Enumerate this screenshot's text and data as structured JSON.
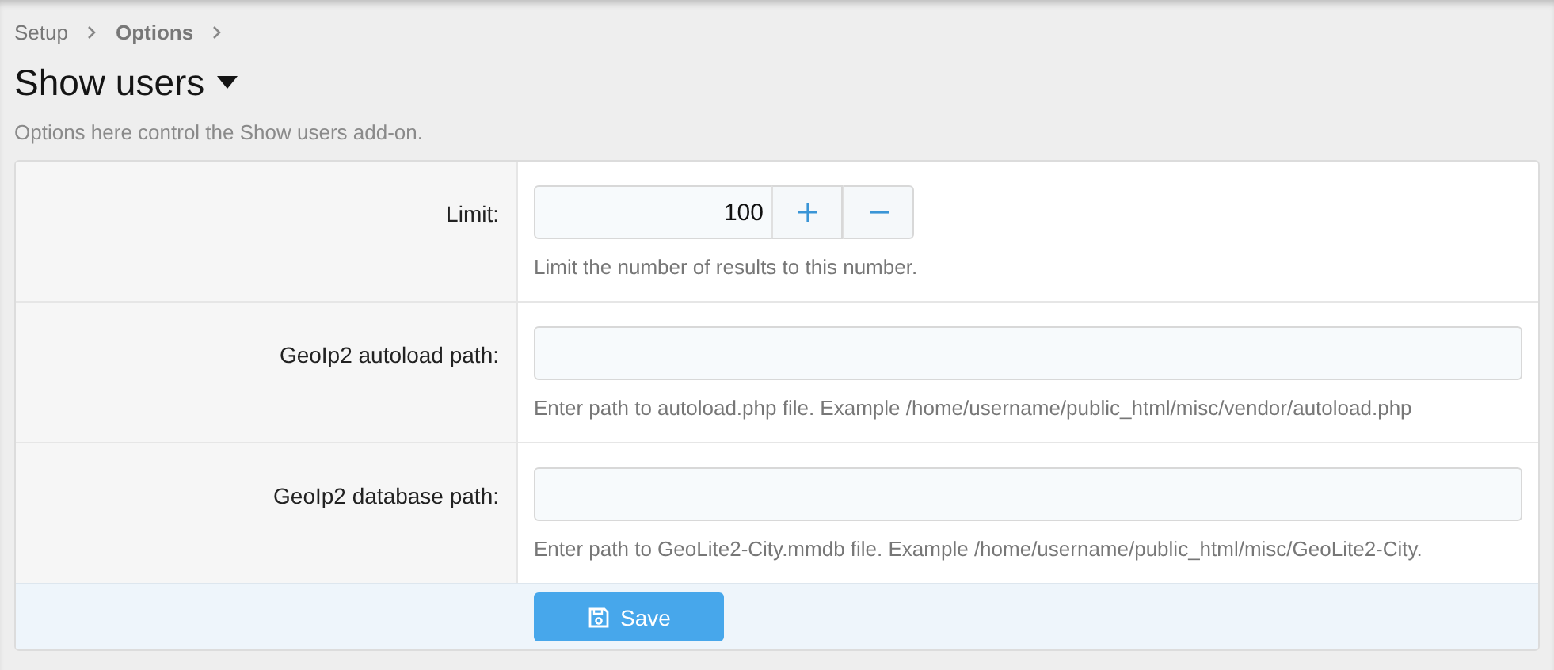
{
  "breadcrumb": [
    {
      "label": "Setup",
      "current": false
    },
    {
      "label": "Options",
      "current": true
    }
  ],
  "title": "Show users",
  "description": "Options here control the Show users add-on.",
  "options": [
    {
      "kind": "number",
      "label": "Limit:",
      "value": "100",
      "hint": "Limit the number of results to this number."
    },
    {
      "kind": "text",
      "label": "GeoIp2 autoload path:",
      "hint": "Enter path to autoload.php file. Example /home/username/public_html/misc/vendor/autoload.php"
    },
    {
      "kind": "text",
      "label": "GeoIp2 database path:",
      "hint": "Enter path to GeoLite2-City.mmdb file. Example /home/username/public_html/misc/GeoLite2-City."
    }
  ],
  "save_button": {
    "label": "Save"
  }
}
